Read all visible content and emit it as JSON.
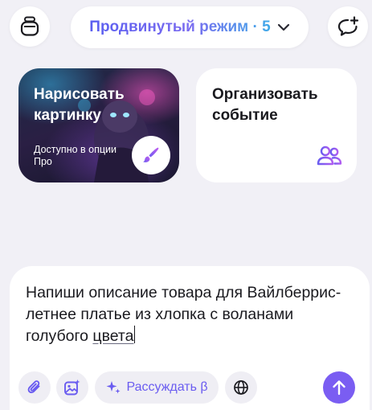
{
  "header": {
    "menu_icon": "stack-icon",
    "mode_label": "Продвинутый режим · 5",
    "mode_chevron_icon": "chevron-down-icon",
    "new_chat_icon": "chat-plus-icon"
  },
  "cards": {
    "draw": {
      "title": "Нарисовать картинку",
      "subtitle": "Доступно в опции Про",
      "icon": "brush-icon"
    },
    "event": {
      "title": "Организовать событие",
      "icon": "people-icon"
    }
  },
  "composer": {
    "prompt_text_before": "Напиши описание товара для Вайлберрис- летнее платье из хлопка с воланами голубого ",
    "prompt_text_underlined": "цвета",
    "attach_icon": "paperclip-icon",
    "image_icon": "image-sparkle-icon",
    "reason_label": "Рассуждать β",
    "reason_icon": "sparkle-icon",
    "web_icon": "globe-icon",
    "send_icon": "arrow-up-icon"
  },
  "colors": {
    "accent": "#7a5df2",
    "background": "#f1f0f6",
    "reason_text": "#6a5cf0"
  }
}
